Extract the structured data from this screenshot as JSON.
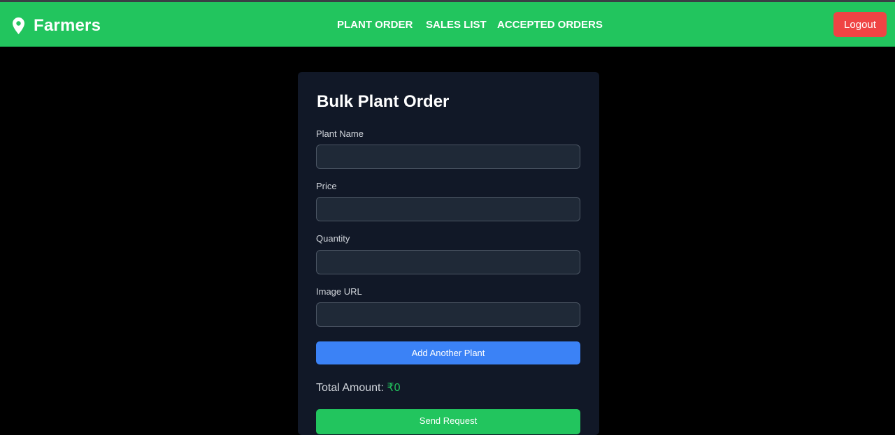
{
  "navbar": {
    "brand": "Farmers",
    "brand_icon": "map-pin-icon",
    "links": [
      "PLANT ORDER",
      "SALES LIST",
      "ACCEPTED ORDERS"
    ],
    "logout_label": "Logout",
    "colors": {
      "bar": "#22c55e",
      "logout": "#ef4444"
    }
  },
  "form": {
    "title": "Bulk Plant Order",
    "fields": [
      {
        "label": "Plant Name",
        "value": ""
      },
      {
        "label": "Price",
        "value": ""
      },
      {
        "label": "Quantity",
        "value": ""
      },
      {
        "label": "Image URL",
        "value": ""
      }
    ],
    "add_button": "Add Another Plant",
    "total_label": "Total Amount:",
    "total_value": "₹0",
    "send_button": "Send Request",
    "colors": {
      "card": "#111827",
      "add": "#3b82f6",
      "send": "#22c55e"
    }
  }
}
